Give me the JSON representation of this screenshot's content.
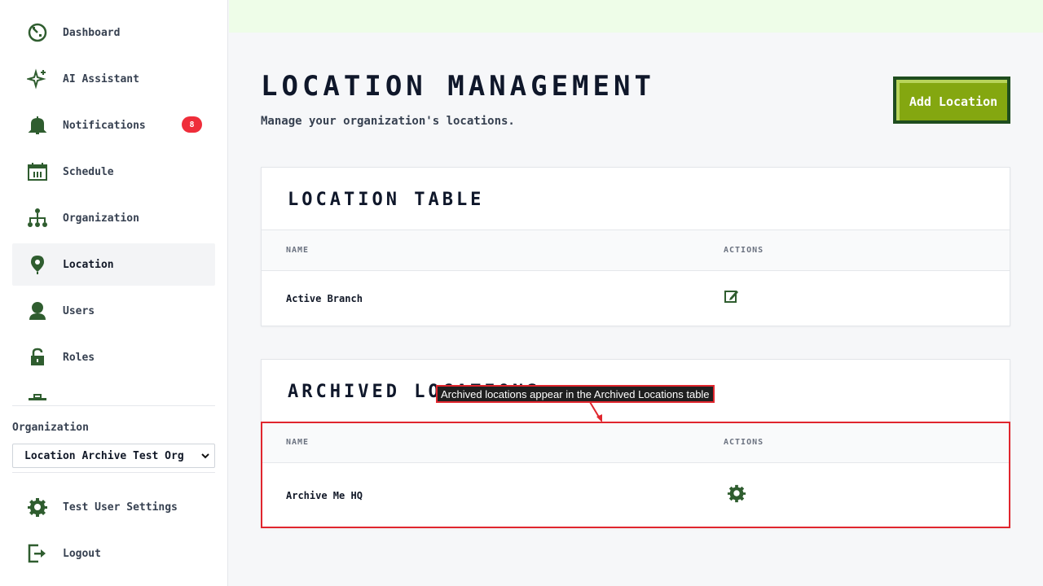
{
  "sidebar": {
    "nav": [
      {
        "label": "Dashboard",
        "icon": "dashboard-icon"
      },
      {
        "label": "AI Assistant",
        "icon": "sparkle-icon"
      },
      {
        "label": "Notifications",
        "icon": "bell-icon",
        "badge": "8"
      },
      {
        "label": "Schedule",
        "icon": "calendar-icon"
      },
      {
        "label": "Organization",
        "icon": "org-chart-icon"
      },
      {
        "label": "Location",
        "icon": "map-pin-icon",
        "active": true
      },
      {
        "label": "Users",
        "icon": "user-icon"
      },
      {
        "label": "Roles",
        "icon": "lock-icon"
      }
    ],
    "org_label": "Organization",
    "org_selected": "Location Archive Test Org",
    "settings_label": "Test User Settings",
    "logout_label": "Logout"
  },
  "header": {
    "title": "LOCATION MANAGEMENT",
    "subtitle": "Manage your organization's locations.",
    "add_button": "Add Location"
  },
  "location_table": {
    "title": "LOCATION TABLE",
    "columns": [
      "NAME",
      "ACTIONS"
    ],
    "rows": [
      {
        "name": "Active Branch",
        "action_icon": "edit-icon"
      }
    ]
  },
  "archived_table": {
    "title": "ARCHIVED LOCATIONS",
    "columns": [
      "NAME",
      "ACTIONS"
    ],
    "rows": [
      {
        "name": "Archive Me HQ",
        "action_icon": "gear-icon"
      }
    ]
  },
  "annotation": {
    "text": "Archived locations appear in the Archived Locations table"
  },
  "colors": {
    "accent_green": "#84a710",
    "dark_green": "#1f4d1f",
    "icon_green": "#2f5d2f",
    "badge_red": "#ef2d3a",
    "annotation_red": "#e0262e"
  }
}
